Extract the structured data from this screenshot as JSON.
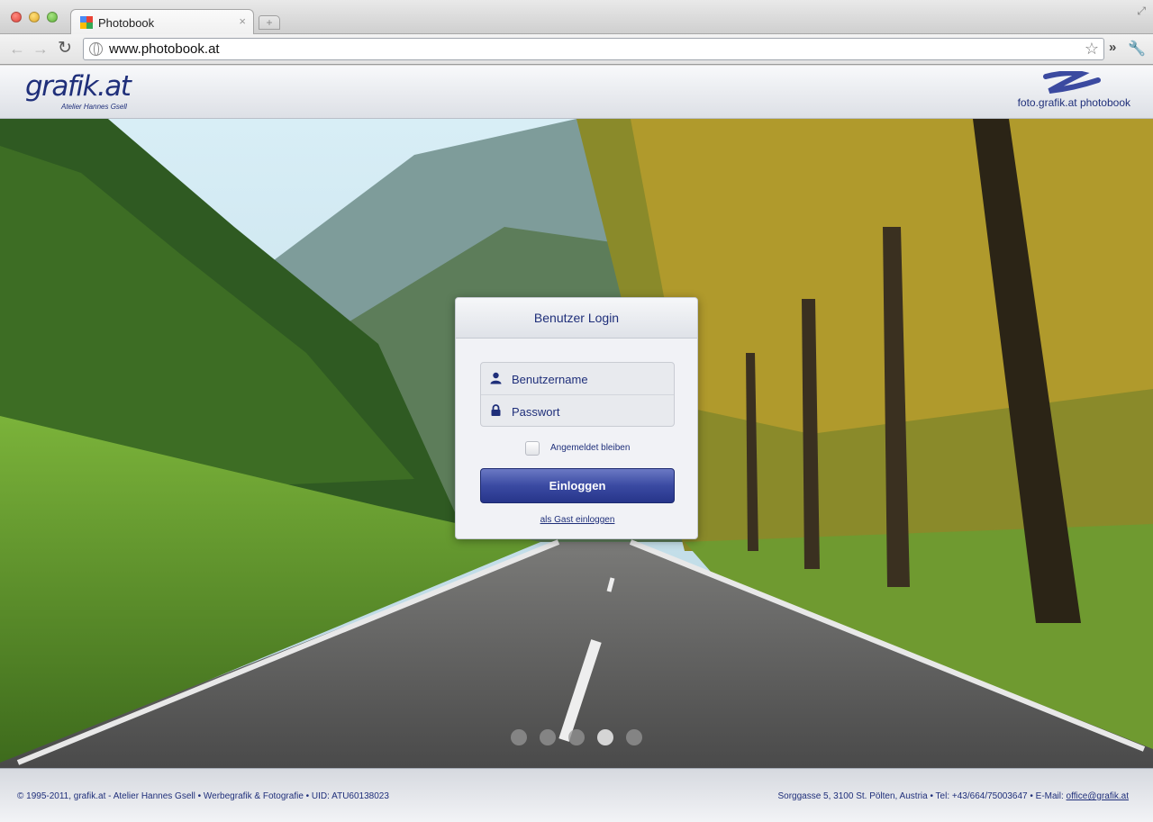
{
  "browser": {
    "tab_title": "Photobook",
    "tab_close": "×",
    "new_tab": "+",
    "url": "www.photobook.at",
    "back_icon": "←",
    "forward_icon": "→",
    "reload_icon": "↻",
    "star_icon": "☆",
    "overflow_icon": "»",
    "wrench_icon": "🔧",
    "resize_icon": "⤢"
  },
  "header": {
    "logo_text": "grafik.at",
    "logo_subtitle": "Atelier Hannes Gsell",
    "brand_text": "foto.grafik.at photobook"
  },
  "login": {
    "title": "Benutzer Login",
    "username_placeholder": "Benutzername",
    "password_placeholder": "Passwort",
    "remember_label": "Angemeldet bleiben",
    "remember_checked": false,
    "submit_label": "Einloggen",
    "guest_link": "als Gast einloggen"
  },
  "slideshow": {
    "dot_count": 5,
    "active_index": 3
  },
  "footer": {
    "left_text": "© 1995-2011, grafik.at - Atelier Hannes Gsell • Werbegrafik & Fotografie • UID: ATU60138023",
    "right_prefix": "Sorggasse 5, 3100 St. Pölten, Austria • Tel: +43/664/75003647 • E-Mail: ",
    "email": "office@grafik.at"
  },
  "colors": {
    "brand_blue": "#1f2f7a",
    "button_blue": "#3a4aa2"
  }
}
